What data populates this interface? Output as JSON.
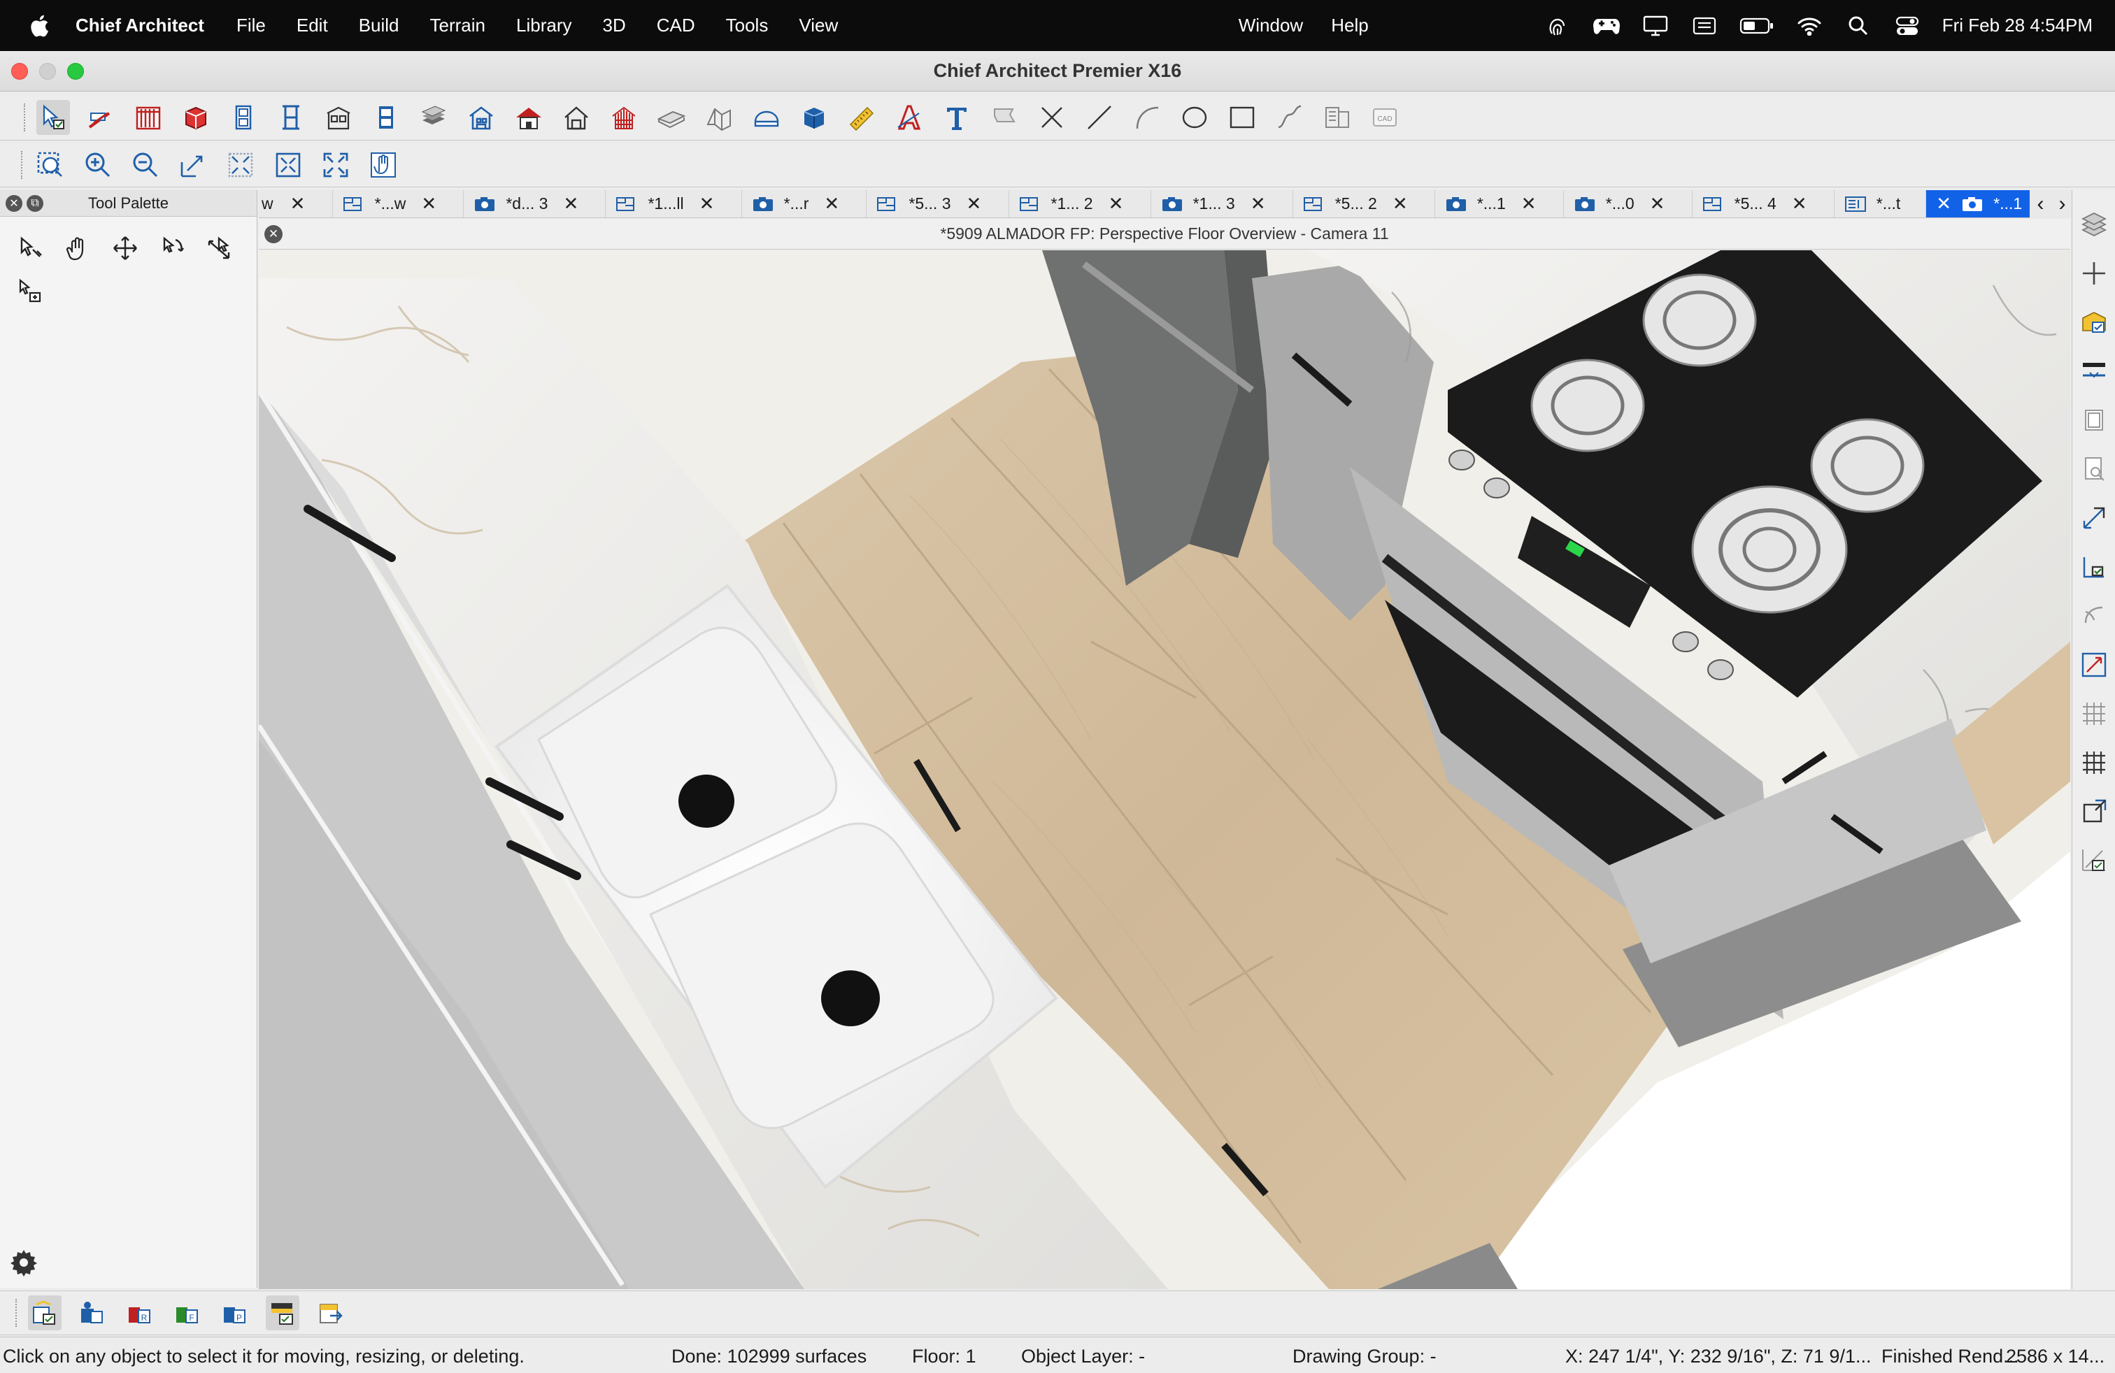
{
  "menubar": {
    "app_name": "Chief Architect",
    "items": [
      "File",
      "Edit",
      "Build",
      "Terrain",
      "Library",
      "3D",
      "CAD",
      "Tools",
      "View"
    ],
    "right_items": [
      "Window",
      "Help"
    ],
    "clock": "Fri Feb 28  4:54PM",
    "status_icons": [
      "fingerprint-icon",
      "game-controller-icon",
      "display-icon",
      "keyboard-brightness-icon",
      "battery-icon",
      "wifi-icon",
      "spotlight-search-icon",
      "control-center-icon"
    ]
  },
  "window": {
    "title": "Chief Architect Premier X16"
  },
  "toolbar_top": {
    "icons": [
      "select-objects-icon",
      "wall-tools-icon",
      "railing-fence-icon",
      "cabinet-icon",
      "door-icon",
      "window-icon",
      "stairs-icon",
      "cabinet-tall-icon",
      "floor-roof-icon",
      "house-build-icon",
      "roof-icon",
      "dormer-icon",
      "framing-icon",
      "slab-icon",
      "terrain-icon",
      "cross-section-icon",
      "3d-box-icon",
      "dimension-ruler-icon",
      "text-style-icon",
      "text-icon",
      "callout-icon",
      "delete-x-icon",
      "line-icon",
      "arc-icon",
      "circle-icon",
      "rectangle-icon",
      "spline-icon",
      "layout-icon",
      "cad-block-icon"
    ]
  },
  "toolbar_zoom": {
    "icons": [
      "zoom-fill-icon",
      "zoom-in-icon",
      "zoom-out-icon",
      "undo-zoom-icon",
      "fill-window-building-icon",
      "fill-window-icon",
      "full-screen-icon",
      "pan-hand-icon"
    ]
  },
  "tool_palette": {
    "title": "Tool Palette",
    "tools": [
      "select-edit-icon",
      "pan-hand-icon",
      "move-arrows-icon",
      "rotate-select-icon",
      "reshape-icon",
      "group-select-icon"
    ]
  },
  "tabs": [
    {
      "label": "w",
      "icon": "",
      "partial": true
    },
    {
      "label": "*...w",
      "icon": "plan-view-icon"
    },
    {
      "label": "*d... 3",
      "icon": "camera-icon"
    },
    {
      "label": "*1...ll",
      "icon": "plan-view-icon"
    },
    {
      "label": "*...r",
      "icon": "camera-icon"
    },
    {
      "label": "*5... 3",
      "icon": "plan-view-icon"
    },
    {
      "label": "*1... 2",
      "icon": "plan-view-icon"
    },
    {
      "label": "*1... 3",
      "icon": "camera-icon"
    },
    {
      "label": "*5... 2",
      "icon": "plan-view-icon"
    },
    {
      "label": "*...1",
      "icon": "camera-icon"
    },
    {
      "label": "*...0",
      "icon": "camera-icon"
    },
    {
      "label": "*5... 4",
      "icon": "plan-view-icon"
    },
    {
      "label": "*...t",
      "icon": "layout-page-icon"
    },
    {
      "label": "*...1",
      "icon": "camera-icon",
      "active": true
    }
  ],
  "view": {
    "title": "*5909 ALMADOR FP: Perspective Floor Overview - Camera 11"
  },
  "sidebar_right": {
    "icons": [
      "layers-icon",
      "add-plus-icon",
      "open-object-icon",
      "material-painter-icon",
      "copy-icon",
      "find-icon",
      "transform-icon",
      "point-to-point-icon",
      "curve-icon",
      "resize-icon",
      "grid-icon",
      "grid-snap-icon",
      "reference-icon",
      "edit-checklist-icon"
    ]
  },
  "toolbar_bottom": {
    "icons": [
      "plan-settings-icon",
      "object-settings-icon",
      "render-icon",
      "framing-view-icon",
      "plot-plan-icon",
      "layer-toggle-icon",
      "export-icon"
    ]
  },
  "statusbar": {
    "hint": "Click on any object to select it for moving, resizing, or deleting.",
    "done": "Done:  102999 surfaces",
    "floor": "Floor: 1",
    "object_layer": "Object Layer: -",
    "drawing_group": "Drawing Group: -",
    "coords": "X: 247 1/4\", Y: 232 9/16\", Z: 71 9/1...",
    "render_state": "Finished Rend...",
    "size": "2586 x 14..."
  },
  "colors": {
    "active_tab": "#1262e8",
    "menubar_bg": "#0c0c0c",
    "floor_wood": "#d9c3a4",
    "cabinet_gray": "#c8c8c8",
    "cooktop_black": "#1b1b1b"
  }
}
